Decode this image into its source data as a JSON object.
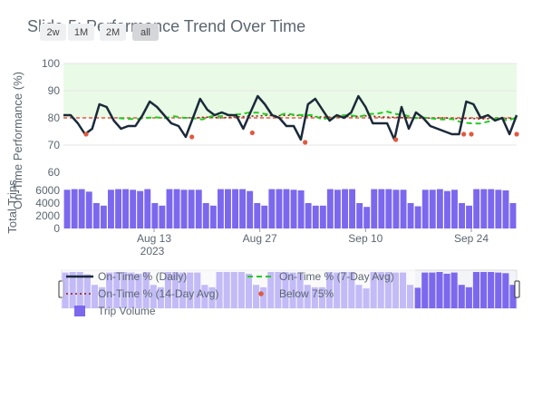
{
  "chart_data": {
    "title": "Slide 5: Performance Trend Over Time",
    "type": "line",
    "range_buttons": [
      {
        "label": "2w",
        "active": false
      },
      {
        "label": "1M",
        "active": false
      },
      {
        "label": "2M",
        "active": false
      },
      {
        "label": "all",
        "active": true
      }
    ],
    "performance_axis": {
      "label": "On-Time Performance (%)",
      "range": [
        65,
        100
      ],
      "ticks": [
        60,
        70,
        80,
        90,
        100
      ],
      "target_band": [
        80,
        100
      ],
      "threshold": 80,
      "grid": true
    },
    "volume_axis": {
      "label": "Total Trips",
      "range": [
        0,
        7000
      ],
      "ticks": [
        0,
        2000,
        4000,
        6000
      ]
    },
    "x_axis": {
      "tick_labels": [
        "Aug 13",
        "Aug 27",
        "Sep 10",
        "Sep 24"
      ],
      "tick_dates": [
        "2023-08-13",
        "2023-08-27",
        "2023-09-10",
        "2023-09-24"
      ],
      "year_label": "2023"
    },
    "dates": [
      "2023-08-01",
      "2023-08-02",
      "2023-08-03",
      "2023-08-04",
      "2023-08-05",
      "2023-08-06",
      "2023-08-07",
      "2023-08-08",
      "2023-08-09",
      "2023-08-10",
      "2023-08-11",
      "2023-08-12",
      "2023-08-13",
      "2023-08-14",
      "2023-08-15",
      "2023-08-16",
      "2023-08-17",
      "2023-08-18",
      "2023-08-19",
      "2023-08-20",
      "2023-08-21",
      "2023-08-22",
      "2023-08-23",
      "2023-08-24",
      "2023-08-25",
      "2023-08-26",
      "2023-08-27",
      "2023-08-28",
      "2023-08-29",
      "2023-08-30",
      "2023-08-31",
      "2023-09-01",
      "2023-09-02",
      "2023-09-03",
      "2023-09-04",
      "2023-09-05",
      "2023-09-06",
      "2023-09-07",
      "2023-09-08",
      "2023-09-09",
      "2023-09-10",
      "2023-09-11",
      "2023-09-12",
      "2023-09-13",
      "2023-09-14",
      "2023-09-15",
      "2023-09-16",
      "2023-09-17",
      "2023-09-18",
      "2023-09-19",
      "2023-09-20",
      "2023-09-21",
      "2023-09-22",
      "2023-09-23",
      "2023-09-24",
      "2023-09-25",
      "2023-09-26",
      "2023-09-27",
      "2023-09-28",
      "2023-09-29",
      "2023-09-30"
    ],
    "series": [
      {
        "name": "On-Time % (Daily)",
        "color": "#1b2a3a",
        "style": "solid",
        "values": [
          81,
          81,
          78,
          74,
          76,
          85,
          84,
          79,
          76,
          77,
          77,
          81,
          86,
          84,
          81,
          78,
          77,
          73,
          80,
          87,
          83,
          81,
          82,
          81,
          81,
          76,
          82,
          88,
          85,
          81,
          80,
          77,
          77,
          72,
          85,
          87,
          83,
          79,
          81,
          80,
          82,
          88,
          84,
          78,
          78,
          78,
          72,
          84,
          76,
          82,
          80,
          77,
          76,
          75,
          74,
          74,
          86,
          85,
          80,
          81,
          79,
          80,
          74,
          81
        ],
        "dates_ref": "dates"
      },
      {
        "name": "On-Time % (7-Day Avg)",
        "color": "#22cc22",
        "style": "dash",
        "values": [
          null,
          null,
          null,
          null,
          null,
          null,
          79.9,
          79.6,
          79.6,
          80.0,
          80.2,
          79.9,
          80.6,
          80.0,
          79.9,
          79.4,
          80.6,
          80.6,
          81.1,
          81.3,
          81.9,
          81.9,
          81.3,
          80.6,
          81.6,
          81.1,
          81.0,
          81.0,
          79.4,
          80.3,
          80.9,
          81.0,
          80.4,
          81.4,
          81.6,
          82.3,
          81.4,
          80.9,
          79.9,
          80.1,
          79.7,
          79.4,
          79.6,
          78.4,
          78.0,
          77.9,
          78.7,
          80.1,
          79.0,
          80.1
        ]
      },
      {
        "name": "On-Time % (14-Day Avg)",
        "color": "#8b1a1a",
        "style": "dot",
        "values": [
          null,
          null,
          null,
          null,
          null,
          null,
          null,
          null,
          null,
          null,
          null,
          null,
          null,
          80.1,
          80.0,
          80.2,
          80.3,
          80.0,
          80.2,
          80.4,
          80.6,
          80.7,
          80.9,
          80.8,
          80.9,
          81.0,
          80.6,
          80.5,
          80.3,
          80.3,
          80.4,
          80.5,
          80.6,
          80.8,
          80.4,
          80.3,
          80.2,
          80.1,
          80.0,
          79.9,
          79.9,
          80.0,
          79.8,
          79.7,
          79.8,
          79.6,
          79.7,
          79.9,
          79.8,
          79.9
        ]
      },
      {
        "name": "Below 75%",
        "color": "#e05a3f",
        "style": "markers",
        "points": [
          [
            "2023-08-04",
            74
          ],
          [
            "2023-08-18",
            73
          ],
          [
            "2023-08-26",
            74.5
          ],
          [
            "2023-09-02",
            71
          ],
          [
            "2023-09-14",
            72
          ],
          [
            "2023-09-23",
            74
          ],
          [
            "2023-09-24",
            74
          ],
          [
            "2023-09-30",
            74
          ]
        ]
      },
      {
        "name": "Trip Volume",
        "color": "#7b68ee",
        "style": "bar",
        "values": [
          6100,
          6200,
          6200,
          5800,
          4000,
          3600,
          6100,
          6200,
          6200,
          6100,
          5900,
          6200,
          4000,
          3600,
          6200,
          6200,
          6100,
          6100,
          6100,
          4000,
          3600,
          6200,
          6200,
          6200,
          6200,
          5900,
          4000,
          3600,
          6200,
          6200,
          6200,
          6100,
          6000,
          4000,
          3600,
          3600,
          6200,
          6100,
          6200,
          6200,
          4000,
          3400,
          6200,
          6200,
          6200,
          6100,
          6100,
          4000,
          3500,
          6100,
          6100,
          6200,
          5900,
          6100,
          4000,
          3600,
          6200,
          6200,
          6200,
          6100,
          6000,
          4000
        ]
      }
    ],
    "legend": {
      "placement": "bottom"
    }
  }
}
